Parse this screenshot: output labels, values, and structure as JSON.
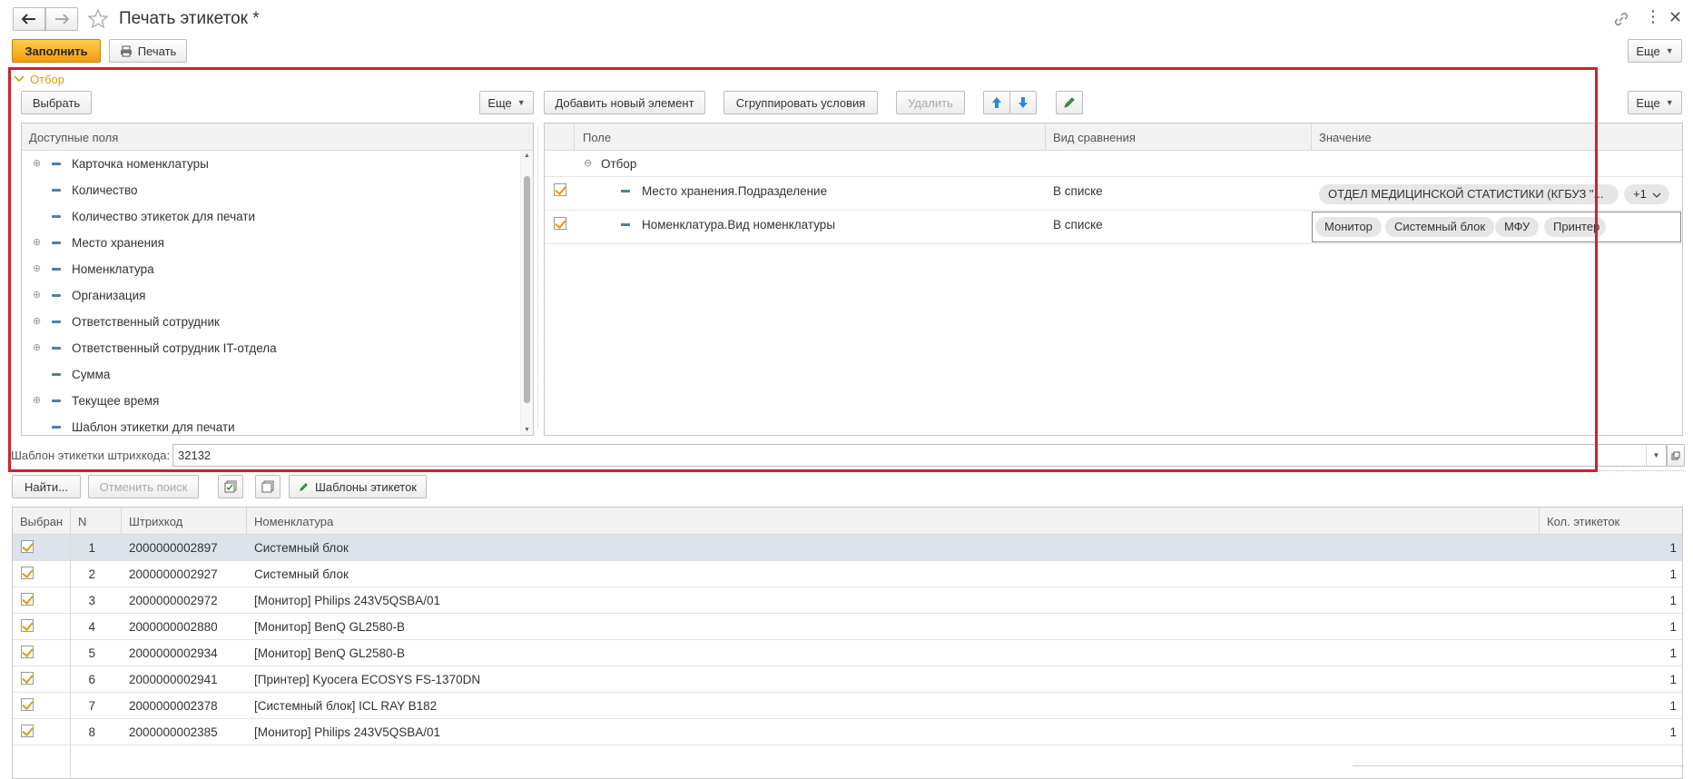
{
  "title": "Печать этикеток *",
  "toolbar": {
    "fill": "Заполнить",
    "print": "Печать",
    "more": "Еще"
  },
  "filter": {
    "section_label": "Отбор",
    "select": "Выбрать",
    "more_left": "Еще",
    "add_new": "Добавить новый элемент",
    "group": "Сгруппировать условия",
    "delete": "Удалить",
    "more_right": "Еще",
    "available_header": "Доступные поля",
    "available_fields": [
      {
        "label": "Карточка номенклатуры",
        "expandable": true
      },
      {
        "label": "Количество",
        "expandable": false
      },
      {
        "label": "Количество этикеток для печати",
        "expandable": false
      },
      {
        "label": "Место хранения",
        "expandable": true
      },
      {
        "label": "Номенклатура",
        "expandable": true
      },
      {
        "label": "Организация",
        "expandable": true
      },
      {
        "label": "Ответственный сотрудник",
        "expandable": true
      },
      {
        "label": "Ответственный сотрудник IT-отдела",
        "expandable": true
      },
      {
        "label": "Сумма",
        "expandable": false
      },
      {
        "label": "Текущее время",
        "expandable": true
      },
      {
        "label": "Шаблон этикетки для печати",
        "expandable": false
      }
    ],
    "cond_headers": {
      "field": "Поле",
      "comparison": "Вид сравнения",
      "value": "Значение"
    },
    "group_node": "Отбор",
    "conditions": [
      {
        "field": "Место хранения.Подразделение",
        "comparison": "В списке",
        "values": [
          "ОТДЕЛ МЕДИЦИНСКОЙ СТАТИСТИКИ (КГБУЗ \"..."
        ],
        "extra": "+1"
      },
      {
        "field": "Номенклатура.Вид номенклатуры",
        "comparison": "В списке",
        "values": [
          "Монитор",
          "Системный блок",
          "МФУ",
          "Принтер"
        ]
      }
    ]
  },
  "template": {
    "label": "Шаблон этикетки штрихкода:",
    "value": "32132"
  },
  "list_toolbar": {
    "find": "Найти...",
    "cancel_search": "Отменить поиск",
    "templates": "Шаблоны этикеток"
  },
  "table": {
    "headers": {
      "selected": "Выбран",
      "n": "N",
      "barcode": "Штрихкод",
      "item": "Номенклатура",
      "count": "Кол. этикеток"
    },
    "rows": [
      {
        "n": "1",
        "barcode": "2000000002897",
        "item": "Системный блок",
        "count": "1"
      },
      {
        "n": "2",
        "barcode": "2000000002927",
        "item": "Системный блок",
        "count": "1"
      },
      {
        "n": "3",
        "barcode": "2000000002972",
        "item": "[Монитор] Philips 243V5QSBA/01",
        "count": "1"
      },
      {
        "n": "4",
        "barcode": "2000000002880",
        "item": "[Монитор] BenQ GL2580-B",
        "count": "1"
      },
      {
        "n": "5",
        "barcode": "2000000002934",
        "item": "[Монитор] BenQ GL2580-B",
        "count": "1"
      },
      {
        "n": "6",
        "barcode": "2000000002941",
        "item": "[Принтер] Kyocera ECOSYS FS-1370DN",
        "count": "1"
      },
      {
        "n": "7",
        "barcode": "2000000002378",
        "item": "[Системный блок] ICL RAY B182",
        "count": "1"
      },
      {
        "n": "8",
        "barcode": "2000000002385",
        "item": "[Монитор] Philips 243V5QSBA/01",
        "count": "1"
      }
    ]
  },
  "colors": {
    "accent": "#f29e0b",
    "highlight_frame": "#d0212b",
    "selected_row": "#dde3ea"
  }
}
